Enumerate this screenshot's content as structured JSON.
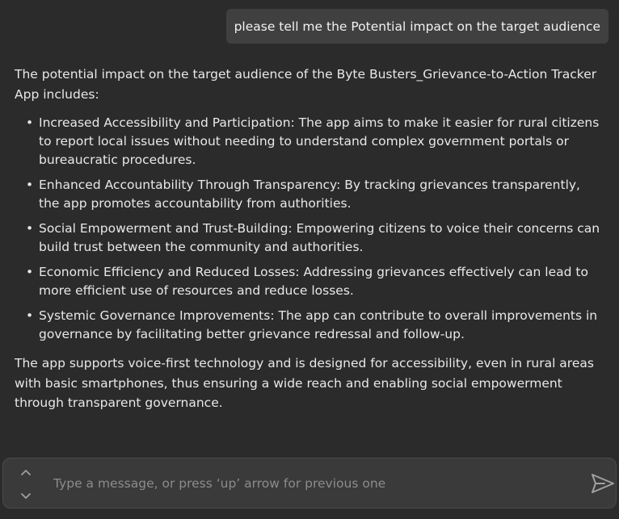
{
  "user_message": "please tell me the Potential impact on the target audience",
  "assistant": {
    "intro": "The potential impact on the target audience of the Byte Busters_Grievance-to-Action Tracker App includes:",
    "points": [
      "Increased Accessibility and Participation: The app aims to make it easier for rural citizens to report local issues without needing to understand complex government portals or bureaucratic procedures.",
      "Enhanced Accountability Through Transparency: By tracking grievances transparently, the app promotes accountability from authorities.",
      "Social Empowerment and Trust-Building: Empowering citizens to voice their concerns can build trust between the community and authorities.",
      "Economic Efficiency and Reduced Losses: Addressing grievances effectively can lead to more efficient use of resources and reduce losses.",
      "Systemic Governance Improvements: The app can contribute to overall improvements in governance by facilitating better grievance redressal and follow-up."
    ],
    "conclusion": "The app supports voice-first technology and is designed for accessibility, even in rural areas with basic smartphones, thus ensuring a wide reach and enabling social empowerment through transparent governance.",
    "bullet": "•"
  },
  "composer": {
    "placeholder": "Type a message, or press ‘up’ arrow for previous one",
    "value": "",
    "history_up_icon": "chevron-up-icon",
    "history_down_icon": "chevron-down-icon",
    "send_icon": "send-icon"
  },
  "colors": {
    "background": "#2b2b2b",
    "user_bubble": "#404040",
    "composer_bg": "#3a3a3a",
    "send_icon": "#a0a0a0"
  }
}
